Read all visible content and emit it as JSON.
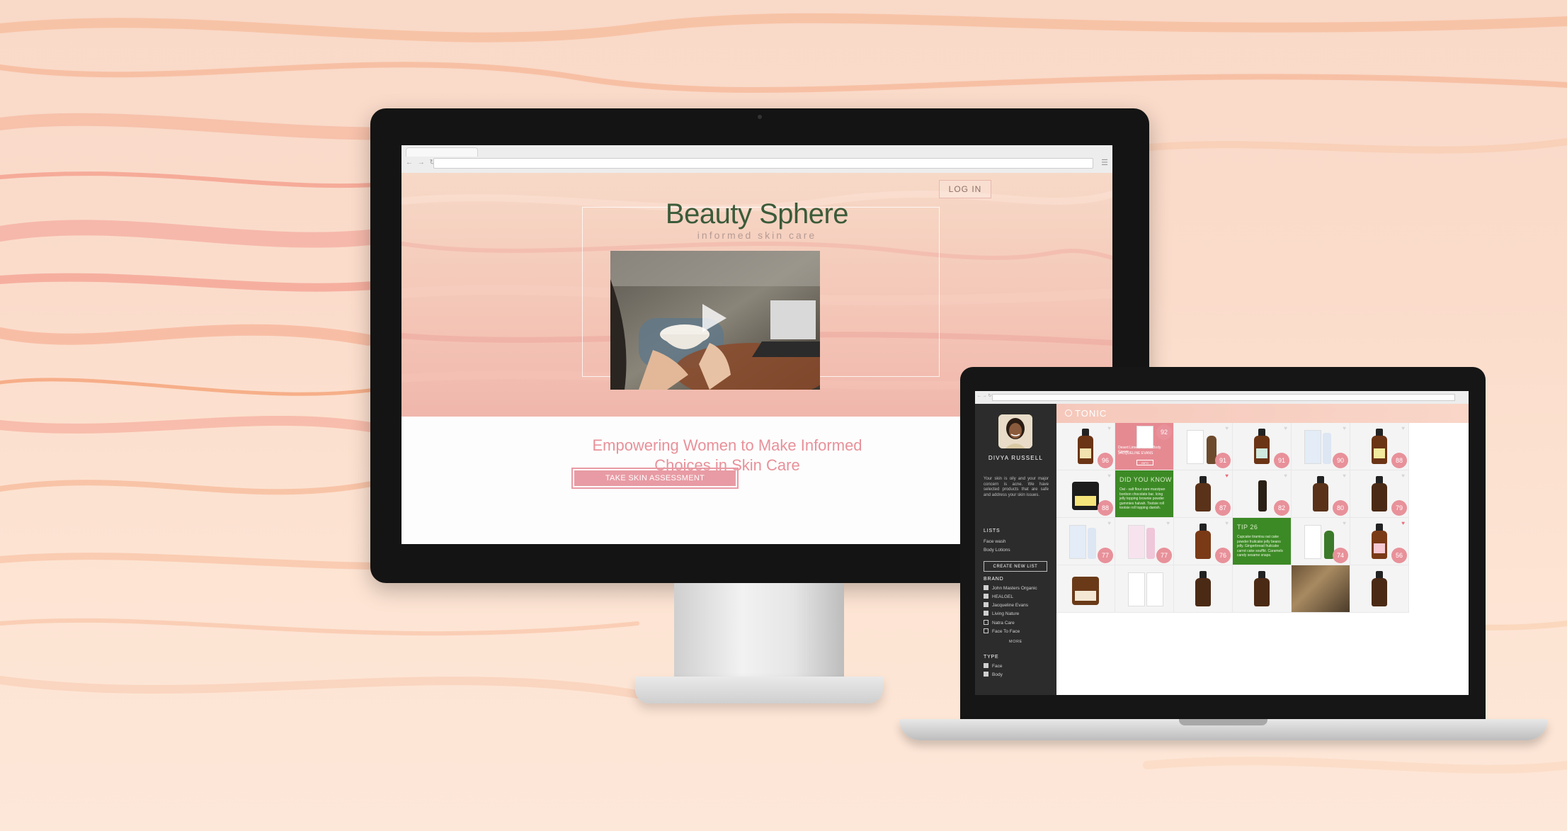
{
  "monitor": {
    "login_label": "LOG IN",
    "brand_title": "Beauty Sphere",
    "brand_subtitle": "informed skin care",
    "tagline_line1": "Empowering Women to Make Informed",
    "tagline_line2": "Choices in Skin Care",
    "cta_label": "TAKE SKIN ASSESSMENT"
  },
  "laptop": {
    "search_text": "TONIC",
    "profile": {
      "name": "DIVYA RUSSELL",
      "description": "Your skin is oily and your major concern is acne. We have selected products that are safe and address your skin issues."
    },
    "lists": {
      "heading": "LISTS",
      "items": [
        "Face wash",
        "Body Lotions"
      ],
      "create_label": "CREATE NEW LIST"
    },
    "brand": {
      "heading": "BRAND",
      "items": [
        {
          "label": "John Masters Organic",
          "checked": true
        },
        {
          "label": "HEALGEL",
          "checked": true
        },
        {
          "label": "Jacqueline Evans",
          "checked": true
        },
        {
          "label": "Living Nature",
          "checked": true
        },
        {
          "label": "Natra Care",
          "checked": false
        },
        {
          "label": "Face To Face",
          "checked": false
        }
      ],
      "more_label": "MORE"
    },
    "type": {
      "heading": "TYPE",
      "items": [
        {
          "label": "Face",
          "checked": true
        },
        {
          "label": "Body",
          "checked": true
        }
      ]
    },
    "scores_row1": [
      "96",
      "92",
      "91",
      "91",
      "90",
      "88"
    ],
    "scores_row2": [
      "88",
      "87",
      "82",
      "80",
      "79"
    ],
    "scores_row3": [
      "77",
      "77",
      "76",
      "74",
      "56"
    ],
    "promo": {
      "title": "Desert Lime & Vanilla Body Cream",
      "brand": "JACQUELINE EVANS",
      "button": "INFO"
    },
    "did_you_know": {
      "heading": "DID YOU KNOW",
      "text": "Oat - salt flour care marzipan bonbon chocolate bar. Icing jelly topping brownie powder gummies halvah. Tootsie roll tootsie roll topping danish."
    },
    "tip": {
      "heading": "TIP 26",
      "text": "Cupcake tiramisu oat cake powder fruitcake jelly beans jelly. Gingerbread fruitcake carrot cake soufflé. Caramels candy sesame snaps."
    }
  }
}
